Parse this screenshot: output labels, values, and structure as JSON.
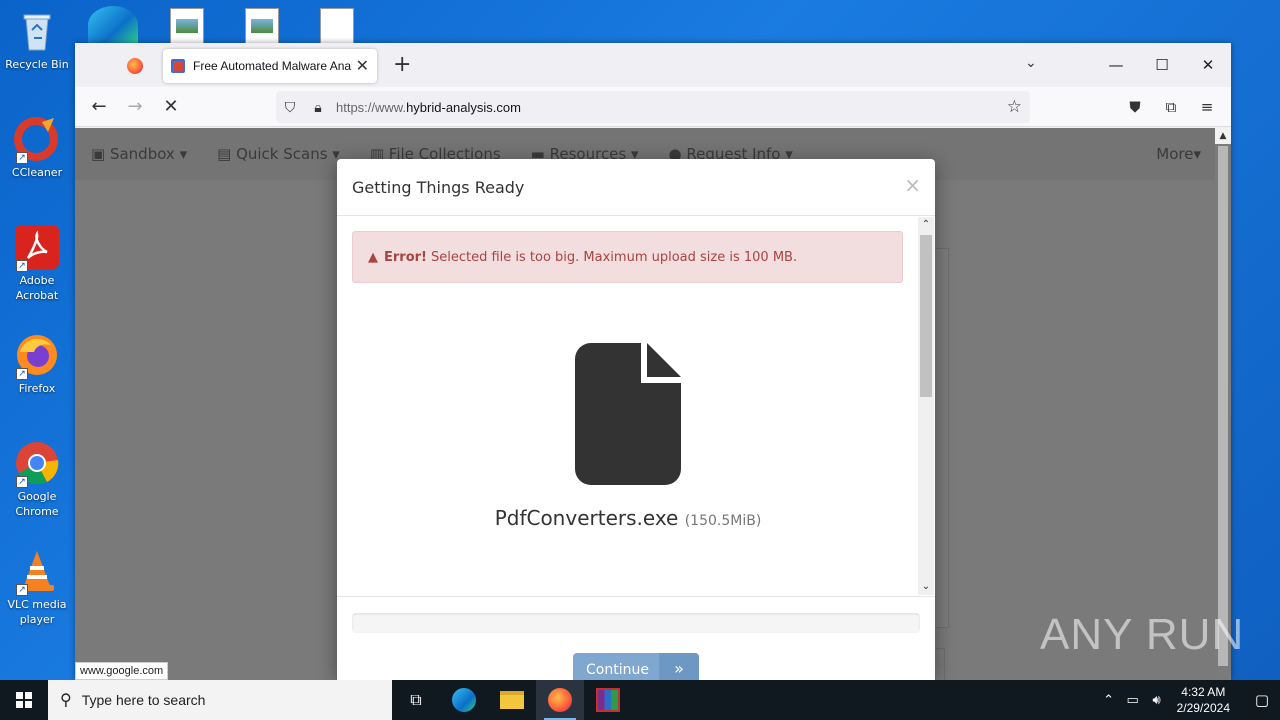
{
  "desktop": {
    "icons": [
      {
        "label": "Recycle Bin"
      },
      {
        "label": "CCleaner"
      },
      {
        "label": "Adobe Acrobat"
      },
      {
        "label": "Firefox"
      },
      {
        "label": "Google Chrome"
      },
      {
        "label": "VLC media player"
      }
    ]
  },
  "browser": {
    "active_tab_title": "Free Automated Malware Analy",
    "url_prefix": "https://www.",
    "url_domain": "hybrid-analysis.com",
    "status_url": "www.google.com"
  },
  "site_nav": {
    "items": [
      "Sandbox ▾",
      "Quick Scans ▾",
      "File Collections",
      "Resources ▾",
      "Request Info ▾"
    ],
    "more": "More▾"
  },
  "modal": {
    "title": "Getting Things Ready",
    "close": "×",
    "alert_strong": "Error!",
    "alert_text": "Selected file is too big. Maximum upload size is 100 MB.",
    "file_name": "PdfConverters.exe",
    "file_size": "(150.5MiB)",
    "progress_percent": 0,
    "continue_label": "Continue"
  },
  "watermark": "ANY RUN",
  "taskbar": {
    "search_placeholder": "Type here to search",
    "time": "4:32 AM",
    "date": "2/29/2024"
  }
}
